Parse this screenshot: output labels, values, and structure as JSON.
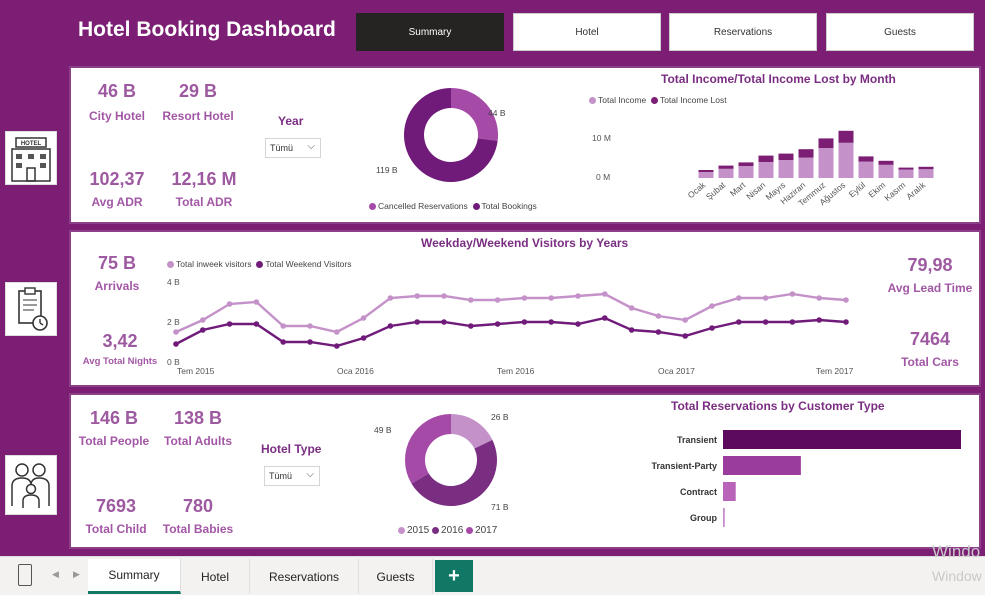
{
  "dashboard": {
    "title": "Hotel Booking Dashboard",
    "nav": [
      "Summary",
      "Hotel",
      "Reservations",
      "Guests"
    ],
    "active_nav": 0
  },
  "colors": {
    "brand": "#7b1e74",
    "light": "#c492c9",
    "mid": "#a64aa8",
    "dark": "#701a7a",
    "darkest": "#5c0a5d",
    "accent": "#117865"
  },
  "icons": [
    "hotel-icon",
    "clipboard-clock-icon",
    "family-icon"
  ],
  "panel1": {
    "kpis": [
      {
        "value": "46 B",
        "label": "City Hotel"
      },
      {
        "value": "29 B",
        "label": "Resort Hotel"
      },
      {
        "value": "102,37",
        "label": "Avg ADR"
      },
      {
        "value": "12,16 M",
        "label": "Total ADR"
      }
    ],
    "slicer": {
      "label": "Year",
      "value": "Tümü"
    },
    "donut": {
      "labels": [
        "44 B",
        "119 B"
      ],
      "legend": [
        "Cancelled Reservations",
        "Total Bookings"
      ]
    }
  },
  "income_chart": {
    "title": "Total Income/Total Income Lost by Month",
    "legend": [
      "Total Income",
      "Total Income Lost"
    ],
    "yticks": [
      "10 M",
      "0 M"
    ]
  },
  "visitors_chart": {
    "title": "Weekday/Weekend Visitors by Years",
    "legend": [
      "Total inweek visitors",
      "Total Weekend Visitors"
    ],
    "yticks": [
      "4 B",
      "2 B",
      "0 B"
    ],
    "xticks": [
      "Tem 2015",
      "Oca 2016",
      "Tem 2016",
      "Oca 2017",
      "Tem 2017"
    ]
  },
  "panel2": {
    "left": [
      {
        "value": "75 B",
        "label": "Arrivals"
      },
      {
        "value": "3,42",
        "label": "Avg Total Nights"
      }
    ],
    "right": [
      {
        "value": "79,98",
        "label": "Avg Lead Time"
      },
      {
        "value": "7464",
        "label": "Total Cars"
      }
    ]
  },
  "panel3": {
    "kpis": [
      {
        "value": "146 B",
        "label": "Total People"
      },
      {
        "value": "138 B",
        "label": "Total Adults"
      },
      {
        "value": "7693",
        "label": "Total Child"
      },
      {
        "value": "780",
        "label": "Total Babies"
      }
    ],
    "slicer": {
      "label": "Hotel Type",
      "value": "Tümü"
    },
    "donut": {
      "labels": [
        "26 B",
        "49 B",
        "71 B"
      ],
      "legend": [
        "2015",
        "2016",
        "2017"
      ]
    }
  },
  "customer_chart": {
    "title": "Total Reservations by Customer Type"
  },
  "tabs": [
    "Summary",
    "Hotel",
    "Reservations",
    "Guests"
  ],
  "active_tab": 0,
  "watermark": [
    "Windo",
    "Window"
  ],
  "chart_data": [
    {
      "type": "bar",
      "title": "Total Income/Total Income Lost by Month",
      "categories": [
        "Ocak",
        "Şubat",
        "Mart",
        "Nisan",
        "Mayıs",
        "Haziran",
        "Temmuz",
        "Ağustos",
        "Eylül",
        "Ekim",
        "Kasım",
        "Aralık"
      ],
      "series": [
        {
          "name": "Total Income",
          "values": [
            1.5,
            2.3,
            3.0,
            4.0,
            4.5,
            5.1,
            7.5,
            8.8,
            4.1,
            3.3,
            2.1,
            2.2
          ]
        },
        {
          "name": "Total Income Lost",
          "values": [
            0.5,
            0.8,
            0.9,
            1.6,
            1.6,
            2.1,
            2.4,
            3.0,
            1.3,
            1.0,
            0.5,
            0.6
          ]
        }
      ],
      "ylim": [
        0,
        13
      ]
    },
    {
      "type": "pie",
      "categories": [
        "Cancelled Reservations",
        "Total Bookings"
      ],
      "values": [
        44,
        119
      ]
    },
    {
      "type": "line",
      "title": "Weekday/Weekend Visitors by Years",
      "x": [
        "2015-07",
        "2015-08",
        "2015-09",
        "2015-10",
        "2015-11",
        "2015-12",
        "2016-01",
        "2016-02",
        "2016-03",
        "2016-04",
        "2016-05",
        "2016-06",
        "2016-07",
        "2016-08",
        "2016-09",
        "2016-10",
        "2016-11",
        "2016-12",
        "2017-01",
        "2017-02",
        "2017-03",
        "2017-04",
        "2017-05",
        "2017-06",
        "2017-07",
        "2017-08"
      ],
      "series": [
        {
          "name": "Total inweek visitors",
          "values": [
            1.5,
            2.1,
            2.9,
            3.0,
            1.8,
            1.8,
            1.5,
            2.2,
            3.2,
            3.3,
            3.3,
            3.1,
            3.1,
            3.2,
            3.2,
            3.3,
            3.4,
            2.7,
            2.3,
            2.1,
            2.8,
            3.2,
            3.2,
            3.4,
            3.2,
            3.1
          ]
        },
        {
          "name": "Total Weekend Visitors",
          "values": [
            0.9,
            1.6,
            1.9,
            1.9,
            1.0,
            1.0,
            0.8,
            1.2,
            1.8,
            2.0,
            2.0,
            1.8,
            1.9,
            2.0,
            2.0,
            1.9,
            2.2,
            1.6,
            1.5,
            1.3,
            1.7,
            2.0,
            2.0,
            2.0,
            2.1,
            2.0
          ]
        }
      ],
      "ylim": [
        0,
        4
      ]
    },
    {
      "type": "pie",
      "categories": [
        "2015",
        "2016",
        "2017"
      ],
      "values": [
        26,
        71,
        49
      ]
    },
    {
      "type": "bar",
      "title": "Total Reservations by Customer Type",
      "categories": [
        "Transient",
        "Transient-Party",
        "Contract",
        "Group"
      ],
      "values": [
        89600,
        25100,
        4100,
        577
      ]
    }
  ]
}
